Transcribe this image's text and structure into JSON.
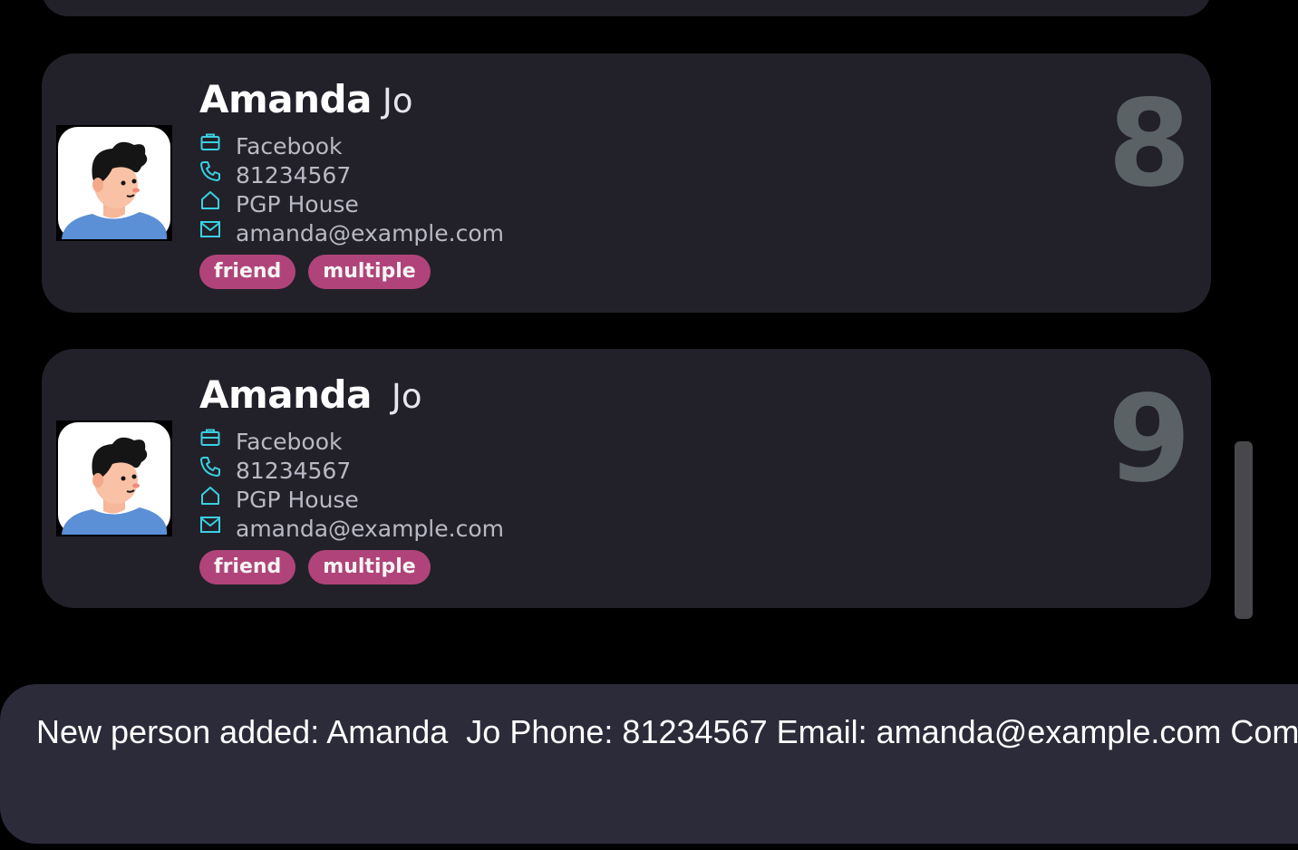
{
  "persons": [
    {
      "first_name": "Amanda",
      "last_name": "Jo",
      "company": "Facebook",
      "phone": "81234567",
      "address": "PGP House",
      "email": "amanda@example.com",
      "tags": [
        "friend",
        "multiple"
      ],
      "index": "8"
    },
    {
      "first_name": "Amanda",
      "last_name": "Jo",
      "company": "Facebook",
      "phone": "81234567",
      "address": "PGP House",
      "email": "amanda@example.com",
      "tags": [
        "friend",
        "multiple"
      ],
      "index": "9"
    }
  ],
  "icons": {
    "company": "briefcase-icon",
    "phone": "phone-icon",
    "address": "home-icon",
    "email": "mail-icon",
    "avatar": "person-avatar"
  },
  "result_display": {
    "message": "New person added: Amanda  Jo Phone: 81234567 Email: amanda@example.com Com"
  },
  "colors": {
    "background": "#000000",
    "card": "#222129",
    "tag": "#b0447a",
    "icon_accent": "#3ad0e0",
    "index_number": "#5b6266",
    "result_box": "#2c2b3a"
  }
}
